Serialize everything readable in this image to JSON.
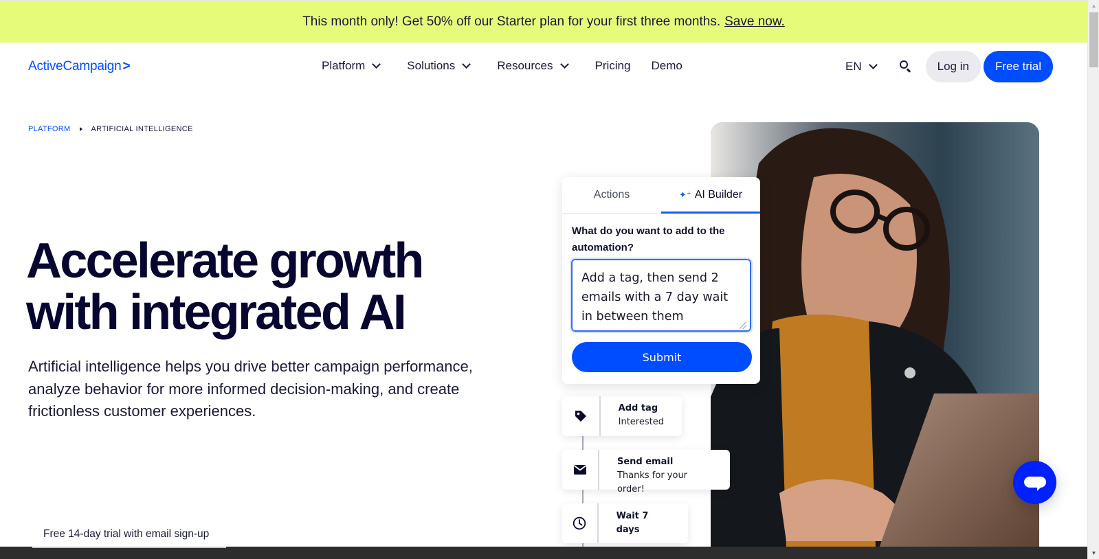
{
  "promo": {
    "text": "This month only! Get 50% off our Starter plan for your first three months.",
    "link": "Save now.",
    "bg_color": "#e7fb7b"
  },
  "nav": {
    "logo": "ActiveCampaign",
    "logo_mark": ">",
    "links": [
      {
        "label": "Platform",
        "dropdown": true
      },
      {
        "label": "Solutions",
        "dropdown": true
      },
      {
        "label": "Resources",
        "dropdown": true
      },
      {
        "label": "Pricing",
        "dropdown": false
      },
      {
        "label": "Demo",
        "dropdown": false
      }
    ],
    "language": "EN",
    "search_icon": "search-icon",
    "login_label": "Log in",
    "trial_label": "Free trial",
    "brand_color": "#004cff"
  },
  "breadcrumb": {
    "items": [
      "PLATFORM",
      "ARTIFICIAL INTELLIGENCE"
    ]
  },
  "hero": {
    "title_line1": "Accelerate growth",
    "title_line2": "with integrated AI",
    "subtitle": "Artificial intelligence helps you drive better campaign performance, analyze behavior for more informed decision-making, and create frictionless customer experiences.",
    "trial_note": "Free 14-day trial with email sign-up"
  },
  "ai_card": {
    "tabs": [
      {
        "label": "Actions",
        "active": false
      },
      {
        "label": "AI Builder",
        "active": true,
        "icon": "sparkle-icon"
      }
    ],
    "prompt_label": "What do you want to add to the automation?",
    "input_value": "Add a tag, then send 2 emails with a 7 day wait in between them",
    "submit_label": "Submit"
  },
  "workflow": {
    "steps": [
      {
        "icon": "tag-icon",
        "title": "Add tag",
        "desc": "Interested"
      },
      {
        "icon": "envelope-icon",
        "title": "Send email",
        "desc": "Thanks for your order!"
      },
      {
        "icon": "clock-icon",
        "title": "Wait 7 days",
        "desc": ""
      }
    ]
  },
  "chat": {
    "icon": "chat-bubble-icon",
    "color": "#0021ff"
  }
}
